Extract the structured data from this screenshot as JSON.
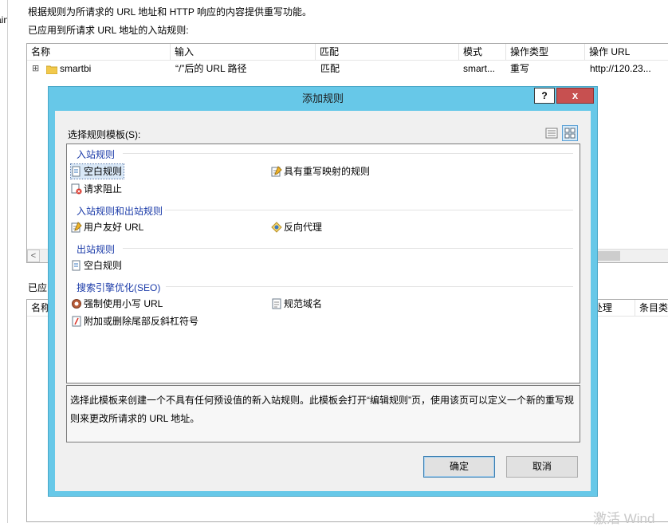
{
  "background": {
    "left_fragment": "ain",
    "intro_text": "根据规则为所请求的 URL 地址和 HTTP 响应的内容提供重写功能。",
    "inbound_label": "已应用到所请求 URL 地址的入站规则:",
    "columns": [
      "名称",
      "输入",
      "匹配",
      "模式",
      "操作类型",
      "操作 URL"
    ],
    "row": {
      "expander": "⊞",
      "name": "smartbi",
      "input": "“/”后的 URL 路径",
      "match": "匹配",
      "pattern": "smart...",
      "action_type": "重写",
      "action_url": "http://120.23..."
    },
    "scroll_left": "<",
    "outbound_label_fragment": "已应",
    "outbound_col_name_fragment": "名称",
    "outbound_col_handler_fragment": "处理",
    "outbound_col_entry_fragment": "条目类",
    "watermark": "激活 Wind"
  },
  "dialog": {
    "title": "添加规则",
    "help_label": "?",
    "close_label": "x",
    "select_label": "选择规则模板(S):",
    "groups": [
      {
        "header": "入站规则",
        "items": [
          {
            "label": "空白规则",
            "icon": "blank-rule-icon"
          },
          {
            "label": "具有重写映射的规则",
            "icon": "rewrite-map-icon"
          },
          {
            "label": "请求阻止",
            "icon": "request-block-icon"
          }
        ]
      },
      {
        "header": "入站规则和出站规则",
        "items": [
          {
            "label": "用户友好 URL",
            "icon": "friendly-url-icon"
          },
          {
            "label": "反向代理",
            "icon": "reverse-proxy-icon"
          }
        ]
      },
      {
        "header": "出站规则",
        "items": [
          {
            "label": "空白规则",
            "icon": "blank-outbound-rule-icon"
          }
        ]
      },
      {
        "header": "搜索引擎优化(SEO)",
        "items": [
          {
            "label": "强制使用小写 URL",
            "icon": "lowercase-url-icon"
          },
          {
            "label": "规范域名",
            "icon": "canonical-domain-icon"
          },
          {
            "label": "附加或删除尾部反斜杠符号",
            "icon": "trailing-slash-icon"
          }
        ]
      }
    ],
    "description": "选择此模板来创建一个不具有任何预设值的新入站规则。此模板会打开“编辑规则”页，使用该页可以定义一个新的重写规则来更改所请求的 URL 地址。",
    "ok_label": "确定",
    "cancel_label": "取消",
    "colors": {
      "frame": "#67c8e8",
      "close": "#c75050",
      "group_header": "#1a3aa8"
    }
  }
}
